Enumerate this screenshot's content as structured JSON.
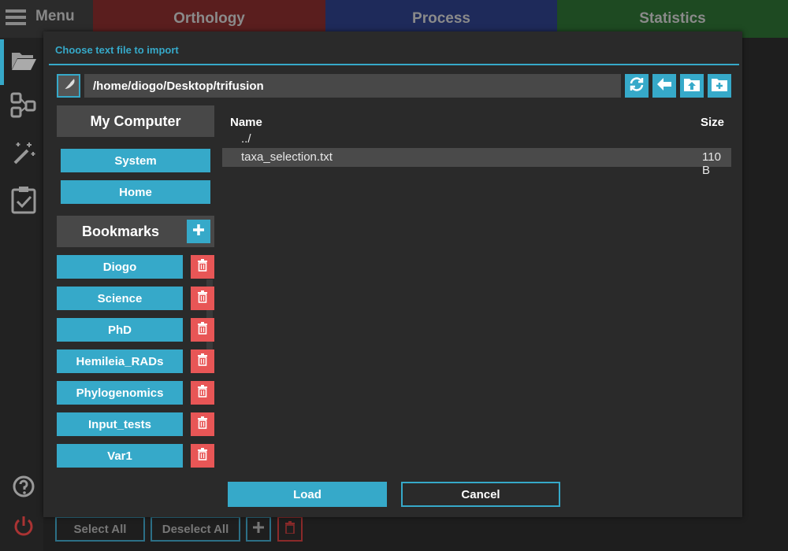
{
  "menu": {
    "label": "Menu"
  },
  "tabs": [
    {
      "label": "Orthology",
      "color": "#5a1e1e"
    },
    {
      "label": "Process",
      "color": "#1e2a5a"
    },
    {
      "label": "Statistics",
      "color": "#1e4a22"
    }
  ],
  "sidebar": {
    "items": [
      "folder-open-icon",
      "network-icon",
      "magic-wand-icon",
      "clipboard-check-icon"
    ],
    "bottom": [
      "help-icon",
      "power-icon"
    ]
  },
  "behind": {
    "select_all": "Select All",
    "deselect_all": "Deselect All"
  },
  "dialog": {
    "title": "Choose text file to import",
    "path": "/home/diogo/Desktop/trifusion",
    "my_computer": "My Computer",
    "system_label": "System",
    "home_label": "Home",
    "bookmarks_label": "Bookmarks",
    "bookmarks": [
      "Diogo",
      "Science",
      "PhD",
      "Hemileia_RADs",
      "Phylogenomics",
      "Input_tests",
      "Var1"
    ],
    "columns": {
      "name": "Name",
      "size": "Size"
    },
    "parent_dir": "../",
    "files": [
      {
        "name": "taxa_selection.txt",
        "size": "110 B"
      }
    ],
    "load_label": "Load",
    "cancel_label": "Cancel"
  },
  "colors": {
    "accent": "#36a9c9",
    "danger": "#e85656"
  }
}
